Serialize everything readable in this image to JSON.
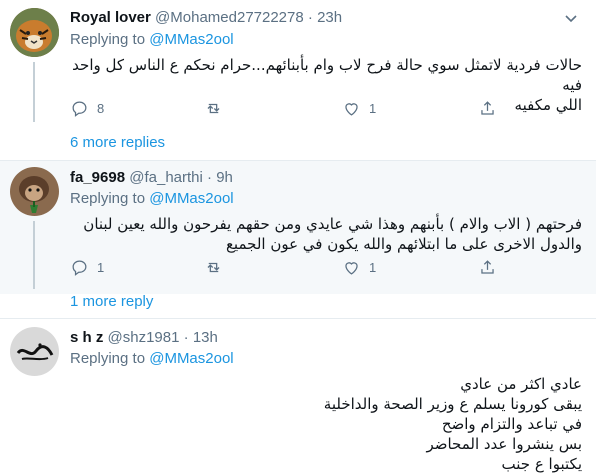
{
  "tweets": [
    {
      "name": "Royal lover",
      "handle": "@Mohamed27722278",
      "dot": "·",
      "time": "23h",
      "replying_label": "Replying to",
      "replying_handle": "@MMas2ool",
      "text_line1": "حالات فردية لاتمثل سوي حالة فرح لاب وام بأبنائهم...حرام نحكم ع الناس  كل واحد فيه",
      "text_line2": "اللي مكفيه",
      "reply_count": "8",
      "retweet_count": "",
      "like_count": "1",
      "more_replies": "6 more replies",
      "avatar_icon": "tiger-avatar"
    },
    {
      "name": "fa_9698",
      "handle": "@fa_harthi",
      "dot": "·",
      "time": "9h",
      "replying_label": "Replying to",
      "replying_handle": "@MMas2ool",
      "text_line1": "فرحتهم ( الاب والام ) بأبنهم وهذا شي عايدي ومن حقهم يفرحون  والله يعين لبنان",
      "text_line2": "والدول الاخرى على ما ابتلائهم والله يكون في عون الجميع",
      "reply_count": "1",
      "retweet_count": "",
      "like_count": "1",
      "more_replies": "1 more reply",
      "avatar_icon": "monkey-avatar"
    },
    {
      "name": "s h z",
      "handle": "@shz1981",
      "dot": "·",
      "time": "13h",
      "replying_label": "Replying to",
      "replying_handle": "@MMas2ool",
      "lines": [
        "عادي اكثر من عادي",
        "يبقى كورونا يسلم ع وزير الصحة والداخلية",
        "في تباعد والتزام واضح",
        "بس ينشروا عدد المحاضر",
        "يكتبوا ع جنب"
      ],
      "avatar_icon": "calligraphy-avatar"
    }
  ],
  "colors": {
    "link": "#1b95e0",
    "secondary": "#5b7083",
    "hover_bg": "#f5f8fa",
    "divider": "#e6ecf0"
  }
}
